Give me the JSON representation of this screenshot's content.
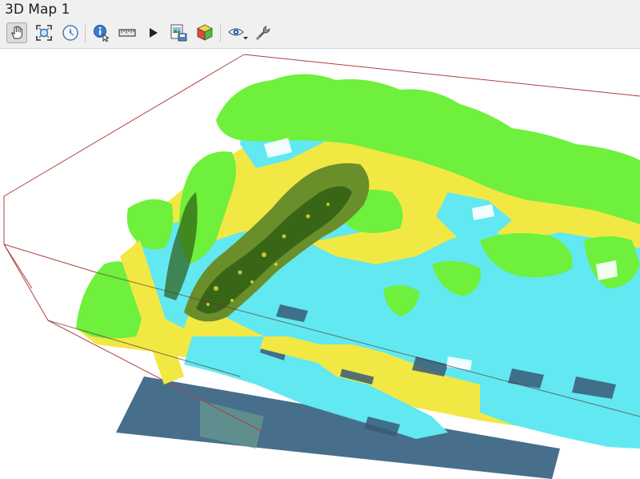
{
  "window": {
    "title": "3D Map 1"
  },
  "toolbar": {
    "tools": [
      {
        "name": "pan-tool-button",
        "icon": "hand-pointer-icon",
        "active": true
      },
      {
        "name": "zoom-full-button",
        "icon": "zoom-full-icon",
        "active": false
      },
      {
        "name": "camera-orient-button",
        "icon": "compass-icon",
        "active": false
      },
      {
        "name": "identify-button",
        "icon": "identify-icon",
        "active": false
      },
      {
        "name": "measure-button",
        "icon": "ruler-icon",
        "active": false
      },
      {
        "name": "animation-button",
        "icon": "play-icon",
        "active": false
      },
      {
        "name": "export-image-button",
        "icon": "save-image-icon",
        "active": false
      },
      {
        "name": "export-3d-button",
        "icon": "cube-export-icon",
        "active": false
      },
      {
        "name": "camera-view-button",
        "icon": "eye-dropdown-icon",
        "active": false
      },
      {
        "name": "configure-button",
        "icon": "wrench-icon",
        "active": false
      }
    ]
  },
  "scene": {
    "colors": {
      "vegetation": "#6ef03d",
      "building": "#62e8f0",
      "ground": "#f2e843",
      "dark_vegetation": "#2d5b12",
      "extent_line": "#b04040",
      "terrain": "#4a7c95"
    }
  }
}
